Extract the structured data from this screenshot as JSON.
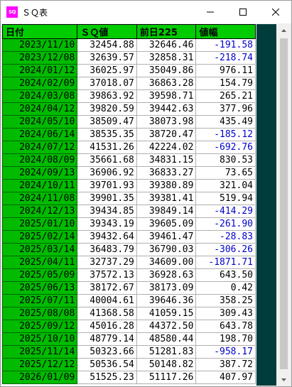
{
  "window": {
    "title": "ＳＱ表",
    "icon_text": "SQ"
  },
  "columns": [
    "日付",
    "ＳＱ値",
    "前日225",
    "値幅"
  ],
  "rows": [
    {
      "date": "2023/11/10",
      "sq": "32454.88",
      "prev": "32646.46",
      "diff": "-191.58",
      "neg": true
    },
    {
      "date": "2023/12/08",
      "sq": "32639.57",
      "prev": "32858.31",
      "diff": "-218.74",
      "neg": true
    },
    {
      "date": "2024/01/12",
      "sq": "36025.97",
      "prev": "35049.86",
      "diff": "976.11",
      "neg": false
    },
    {
      "date": "2024/02/09",
      "sq": "37018.07",
      "prev": "36863.28",
      "diff": "154.79",
      "neg": false
    },
    {
      "date": "2024/03/08",
      "sq": "39863.92",
      "prev": "39598.71",
      "diff": "265.21",
      "neg": false
    },
    {
      "date": "2024/04/12",
      "sq": "39820.59",
      "prev": "39442.63",
      "diff": "377.96",
      "neg": false
    },
    {
      "date": "2024/05/10",
      "sq": "38509.47",
      "prev": "38073.98",
      "diff": "435.49",
      "neg": false
    },
    {
      "date": "2024/06/14",
      "sq": "38535.35",
      "prev": "38720.47",
      "diff": "-185.12",
      "neg": true
    },
    {
      "date": "2024/07/12",
      "sq": "41531.26",
      "prev": "42224.02",
      "diff": "-692.76",
      "neg": true
    },
    {
      "date": "2024/08/09",
      "sq": "35661.68",
      "prev": "34831.15",
      "diff": "830.53",
      "neg": false
    },
    {
      "date": "2024/09/13",
      "sq": "36906.92",
      "prev": "36833.27",
      "diff": "73.65",
      "neg": false
    },
    {
      "date": "2024/10/11",
      "sq": "39701.93",
      "prev": "39380.89",
      "diff": "321.04",
      "neg": false
    },
    {
      "date": "2024/11/08",
      "sq": "39901.35",
      "prev": "39381.41",
      "diff": "519.94",
      "neg": false
    },
    {
      "date": "2024/12/13",
      "sq": "39434.85",
      "prev": "39849.14",
      "diff": "-414.29",
      "neg": true
    },
    {
      "date": "2025/01/10",
      "sq": "39343.19",
      "prev": "39605.09",
      "diff": "-261.90",
      "neg": true
    },
    {
      "date": "2025/02/14",
      "sq": "39432.64",
      "prev": "39461.47",
      "diff": "-28.83",
      "neg": true
    },
    {
      "date": "2025/03/14",
      "sq": "36483.79",
      "prev": "36790.03",
      "diff": "-306.26",
      "neg": true
    },
    {
      "date": "2025/04/11",
      "sq": "32737.29",
      "prev": "34609.00",
      "diff": "-1871.71",
      "neg": true
    },
    {
      "date": "2025/05/09",
      "sq": "37572.13",
      "prev": "36928.63",
      "diff": "643.50",
      "neg": false
    },
    {
      "date": "2025/06/13",
      "sq": "38172.67",
      "prev": "38173.09",
      "diff": "0.42",
      "neg": false
    },
    {
      "date": "2025/07/11",
      "sq": "40004.61",
      "prev": "39646.36",
      "diff": "358.25",
      "neg": false
    },
    {
      "date": "2025/08/08",
      "sq": "41368.58",
      "prev": "41059.15",
      "diff": "309.43",
      "neg": false
    },
    {
      "date": "2025/09/12",
      "sq": "45016.28",
      "prev": "44372.50",
      "diff": "643.78",
      "neg": false
    },
    {
      "date": "2025/10/10",
      "sq": "48779.14",
      "prev": "48580.44",
      "diff": "198.70",
      "neg": false
    },
    {
      "date": "2025/11/14",
      "sq": "50323.66",
      "prev": "51281.83",
      "diff": "-958.17",
      "neg": true
    },
    {
      "date": "2025/12/12",
      "sq": "50536.54",
      "prev": "50148.82",
      "diff": "387.72",
      "neg": false
    },
    {
      "date": "2026/01/09",
      "sq": "51525.23",
      "prev": "51117.26",
      "diff": "407.97",
      "neg": false
    }
  ],
  "colors": {
    "header_bg": "#00cc00",
    "date_bg": "#00bb00",
    "negative_text": "#0000cc",
    "side_panel": "#003c3c",
    "app_icon": "#ff00ff"
  }
}
